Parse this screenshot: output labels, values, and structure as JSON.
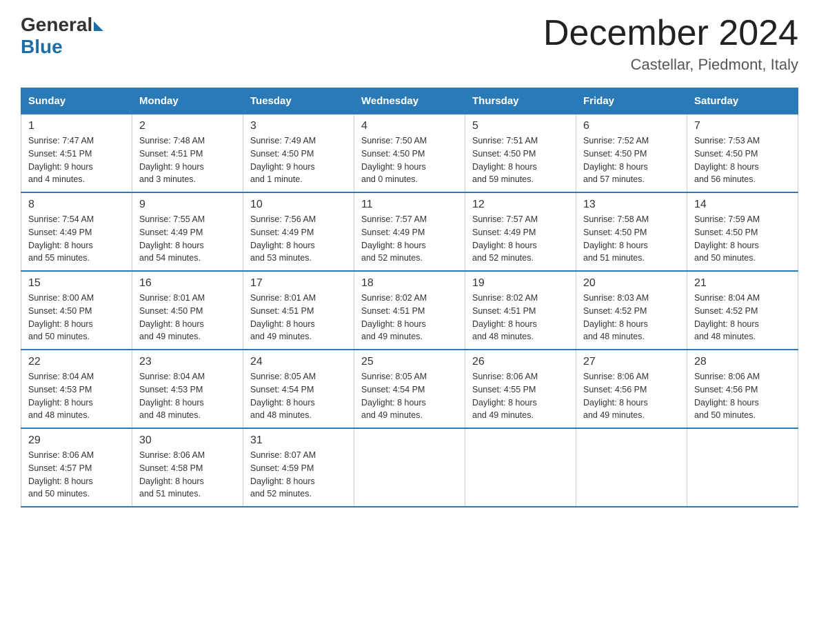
{
  "logo": {
    "general": "General",
    "blue": "Blue"
  },
  "title": "December 2024",
  "location": "Castellar, Piedmont, Italy",
  "headers": [
    "Sunday",
    "Monday",
    "Tuesday",
    "Wednesday",
    "Thursday",
    "Friday",
    "Saturday"
  ],
  "weeks": [
    [
      {
        "day": "1",
        "info": "Sunrise: 7:47 AM\nSunset: 4:51 PM\nDaylight: 9 hours\nand 4 minutes."
      },
      {
        "day": "2",
        "info": "Sunrise: 7:48 AM\nSunset: 4:51 PM\nDaylight: 9 hours\nand 3 minutes."
      },
      {
        "day": "3",
        "info": "Sunrise: 7:49 AM\nSunset: 4:50 PM\nDaylight: 9 hours\nand 1 minute."
      },
      {
        "day": "4",
        "info": "Sunrise: 7:50 AM\nSunset: 4:50 PM\nDaylight: 9 hours\nand 0 minutes."
      },
      {
        "day": "5",
        "info": "Sunrise: 7:51 AM\nSunset: 4:50 PM\nDaylight: 8 hours\nand 59 minutes."
      },
      {
        "day": "6",
        "info": "Sunrise: 7:52 AM\nSunset: 4:50 PM\nDaylight: 8 hours\nand 57 minutes."
      },
      {
        "day": "7",
        "info": "Sunrise: 7:53 AM\nSunset: 4:50 PM\nDaylight: 8 hours\nand 56 minutes."
      }
    ],
    [
      {
        "day": "8",
        "info": "Sunrise: 7:54 AM\nSunset: 4:49 PM\nDaylight: 8 hours\nand 55 minutes."
      },
      {
        "day": "9",
        "info": "Sunrise: 7:55 AM\nSunset: 4:49 PM\nDaylight: 8 hours\nand 54 minutes."
      },
      {
        "day": "10",
        "info": "Sunrise: 7:56 AM\nSunset: 4:49 PM\nDaylight: 8 hours\nand 53 minutes."
      },
      {
        "day": "11",
        "info": "Sunrise: 7:57 AM\nSunset: 4:49 PM\nDaylight: 8 hours\nand 52 minutes."
      },
      {
        "day": "12",
        "info": "Sunrise: 7:57 AM\nSunset: 4:49 PM\nDaylight: 8 hours\nand 52 minutes."
      },
      {
        "day": "13",
        "info": "Sunrise: 7:58 AM\nSunset: 4:50 PM\nDaylight: 8 hours\nand 51 minutes."
      },
      {
        "day": "14",
        "info": "Sunrise: 7:59 AM\nSunset: 4:50 PM\nDaylight: 8 hours\nand 50 minutes."
      }
    ],
    [
      {
        "day": "15",
        "info": "Sunrise: 8:00 AM\nSunset: 4:50 PM\nDaylight: 8 hours\nand 50 minutes."
      },
      {
        "day": "16",
        "info": "Sunrise: 8:01 AM\nSunset: 4:50 PM\nDaylight: 8 hours\nand 49 minutes."
      },
      {
        "day": "17",
        "info": "Sunrise: 8:01 AM\nSunset: 4:51 PM\nDaylight: 8 hours\nand 49 minutes."
      },
      {
        "day": "18",
        "info": "Sunrise: 8:02 AM\nSunset: 4:51 PM\nDaylight: 8 hours\nand 49 minutes."
      },
      {
        "day": "19",
        "info": "Sunrise: 8:02 AM\nSunset: 4:51 PM\nDaylight: 8 hours\nand 48 minutes."
      },
      {
        "day": "20",
        "info": "Sunrise: 8:03 AM\nSunset: 4:52 PM\nDaylight: 8 hours\nand 48 minutes."
      },
      {
        "day": "21",
        "info": "Sunrise: 8:04 AM\nSunset: 4:52 PM\nDaylight: 8 hours\nand 48 minutes."
      }
    ],
    [
      {
        "day": "22",
        "info": "Sunrise: 8:04 AM\nSunset: 4:53 PM\nDaylight: 8 hours\nand 48 minutes."
      },
      {
        "day": "23",
        "info": "Sunrise: 8:04 AM\nSunset: 4:53 PM\nDaylight: 8 hours\nand 48 minutes."
      },
      {
        "day": "24",
        "info": "Sunrise: 8:05 AM\nSunset: 4:54 PM\nDaylight: 8 hours\nand 48 minutes."
      },
      {
        "day": "25",
        "info": "Sunrise: 8:05 AM\nSunset: 4:54 PM\nDaylight: 8 hours\nand 49 minutes."
      },
      {
        "day": "26",
        "info": "Sunrise: 8:06 AM\nSunset: 4:55 PM\nDaylight: 8 hours\nand 49 minutes."
      },
      {
        "day": "27",
        "info": "Sunrise: 8:06 AM\nSunset: 4:56 PM\nDaylight: 8 hours\nand 49 minutes."
      },
      {
        "day": "28",
        "info": "Sunrise: 8:06 AM\nSunset: 4:56 PM\nDaylight: 8 hours\nand 50 minutes."
      }
    ],
    [
      {
        "day": "29",
        "info": "Sunrise: 8:06 AM\nSunset: 4:57 PM\nDaylight: 8 hours\nand 50 minutes."
      },
      {
        "day": "30",
        "info": "Sunrise: 8:06 AM\nSunset: 4:58 PM\nDaylight: 8 hours\nand 51 minutes."
      },
      {
        "day": "31",
        "info": "Sunrise: 8:07 AM\nSunset: 4:59 PM\nDaylight: 8 hours\nand 52 minutes."
      },
      {
        "day": "",
        "info": ""
      },
      {
        "day": "",
        "info": ""
      },
      {
        "day": "",
        "info": ""
      },
      {
        "day": "",
        "info": ""
      }
    ]
  ]
}
